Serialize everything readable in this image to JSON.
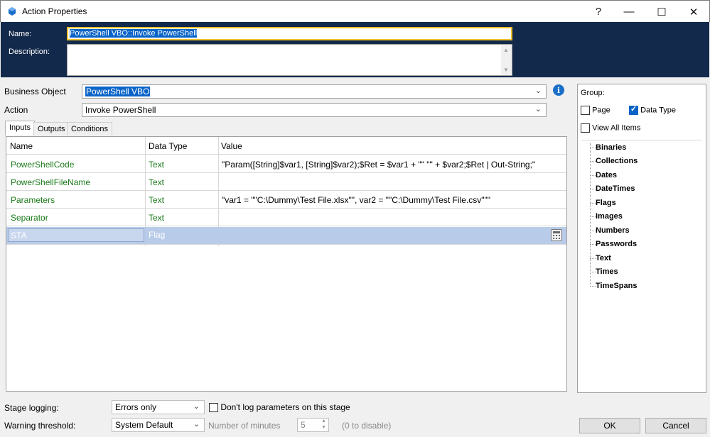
{
  "window": {
    "title": "Action Properties",
    "help_glyph": "?",
    "minimize_glyph": "—",
    "maximize_glyph": "☐",
    "close_glyph": "✕"
  },
  "header": {
    "name_label": "Name:",
    "name_value": "PowerShell VBO::Invoke PowerShell",
    "description_label": "Description:",
    "description_value": ""
  },
  "business_object": {
    "label": "Business Object",
    "value": "PowerShell VBO"
  },
  "action": {
    "label": "Action",
    "value": "Invoke PowerShell"
  },
  "tabs": [
    {
      "label": "Inputs",
      "active": true
    },
    {
      "label": "Outputs",
      "active": false
    },
    {
      "label": "Conditions",
      "active": false
    }
  ],
  "grid": {
    "columns": [
      "Name",
      "Data Type",
      "Value"
    ],
    "rows": [
      {
        "name": "PowerShellCode",
        "type": "Text",
        "value": "\"Param([String]$var1, [String]$var2);$Ret = $var1 + \"\" \"\" + $var2;$Ret | Out-String;\""
      },
      {
        "name": "PowerShellFileName",
        "type": "Text",
        "value": ""
      },
      {
        "name": "Parameters",
        "type": "Text",
        "value": "\"var1 = \"\"C:\\Dummy\\Test File.xlsx\"\", var2 = \"\"C:\\Dummy\\Test File.csv\"\"\""
      },
      {
        "name": "Separator",
        "type": "Text",
        "value": ""
      },
      {
        "name": "STA",
        "type": "Flag",
        "value": ""
      }
    ]
  },
  "group": {
    "label": "Group:",
    "page_label": "Page",
    "page_checked": false,
    "datatype_label": "Data Type",
    "datatype_checked": true,
    "view_all_label": "View All Items",
    "view_all_checked": false,
    "items": [
      "Binaries",
      "Collections",
      "Dates",
      "DateTimes",
      "Flags",
      "Images",
      "Numbers",
      "Passwords",
      "Text",
      "Times",
      "TimeSpans"
    ]
  },
  "footer": {
    "stage_logging_label": "Stage logging:",
    "stage_logging_value": "Errors only",
    "dont_log_label": "Don't log parameters on this stage",
    "warning_label": "Warning threshold:",
    "warning_value": "System Default",
    "minutes_label": "Number of minutes",
    "minutes_value": "5",
    "disable_hint": "(0 to disable)",
    "ok_label": "OK",
    "cancel_label": "Cancel"
  },
  "colors": {
    "header_bg": "#13294b",
    "selection": "#0a64c8",
    "green_text": "#1a7a1a",
    "selected_row": "#b8cbe9"
  }
}
